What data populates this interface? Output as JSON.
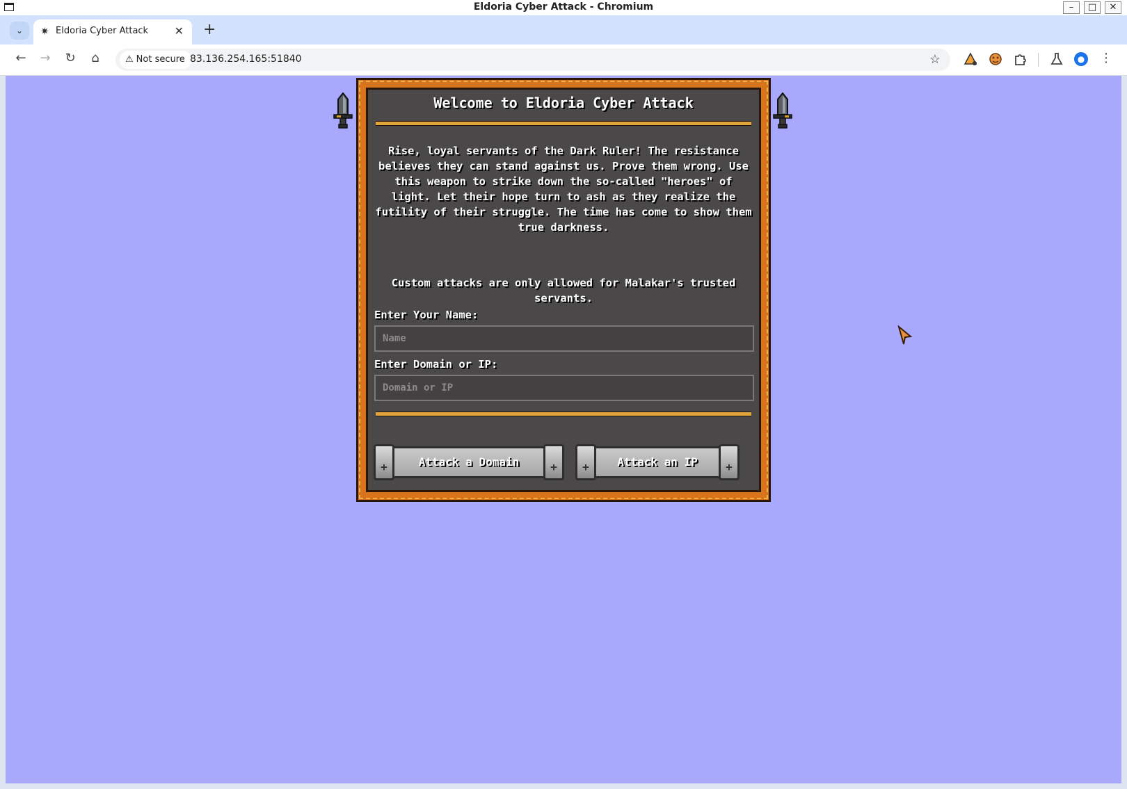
{
  "window": {
    "title": "Eldoria Cyber Attack - Chromium",
    "min_glyph": "–",
    "max_glyph": "□",
    "close_glyph": "✕"
  },
  "tabs": {
    "menu_glyph": "⌄",
    "active_title": "Eldoria Cyber Attack",
    "favicon_glyph": "✷",
    "close_glyph": "✕",
    "new_tab_glyph": "+"
  },
  "toolbar": {
    "back_glyph": "←",
    "forward_glyph": "→",
    "reload_glyph": "↻",
    "home_glyph": "⌂",
    "security_label": "Not secure",
    "security_glyph": "⚠",
    "url": "83.136.254.165:51840",
    "star_glyph": "☆",
    "extensions": [
      "extension-wizard-icon",
      "cookie-icon",
      "puzzle-icon",
      "labs-icon"
    ],
    "profile_glyph": "●",
    "menu_glyph": "⋮"
  },
  "game": {
    "title": "Welcome to Eldoria Cyber Attack",
    "story": "Rise, loyal servants of the Dark Ruler! The resistance believes they can stand against us. Prove them wrong. Use this weapon to strike down the so-called \"heroes\" of light. Let their hope turn to ash as they realize the futility of their struggle. The time has come to show them true darkness.",
    "notice": "Custom attacks are only allowed for Malakar's trusted servants.",
    "name_label": "Enter Your Name:",
    "name_placeholder": "Name",
    "target_label": "Enter Domain or IP:",
    "target_placeholder": "Domain or IP",
    "attack_domain_label": "Attack a Domain",
    "attack_ip_label": "Attack an IP"
  },
  "colors": {
    "page_background": "#a8a8fc",
    "panel_background": "#4a4849",
    "panel_border": "#d8741b",
    "rule": "#e0a63c"
  }
}
